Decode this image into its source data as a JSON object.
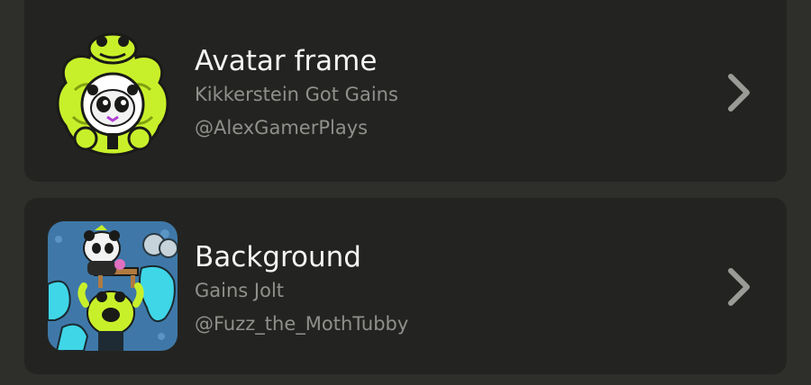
{
  "items": [
    {
      "type_label": "Avatar frame",
      "item_name": "Kikkerstein Got Gains",
      "creator": "@AlexGamerPlays",
      "thumbnail_icon": "frog-avatar-frame-icon"
    },
    {
      "type_label": "Background",
      "item_name": "Gains Jolt",
      "creator": "@Fuzz_the_MothTubby",
      "thumbnail_icon": "panda-frog-background-icon"
    }
  ],
  "colors": {
    "page_bg": "#2e2f2b",
    "card_bg": "#232421",
    "title": "#f4f4f2",
    "secondary_text": "#8f908c",
    "accent_green": "#c8f02a",
    "chevron": "#9a9b97"
  }
}
